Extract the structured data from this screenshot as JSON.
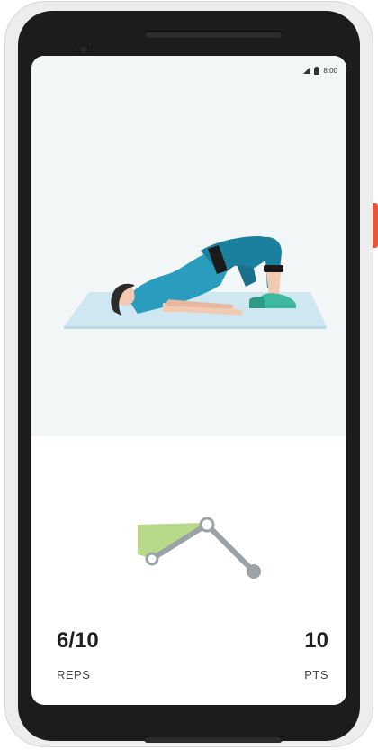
{
  "status_bar": {
    "time": "8:00",
    "icons": [
      "signal-icon",
      "battery-icon"
    ]
  },
  "exercise": {
    "illustration": "glute-bridge-illustration",
    "angle_indicator": "joint-angle-indicator"
  },
  "stats": {
    "reps_value": "6/10",
    "reps_label": "REPS",
    "points_value": "10",
    "points_label": "PTS"
  },
  "colors": {
    "accent_teal": "#1f8fb0",
    "wedge_green": "#b8d98a",
    "joint_gray": "#9aa3a8",
    "hero_background": "#f3f6f6",
    "mat": "#cfe7f1"
  }
}
